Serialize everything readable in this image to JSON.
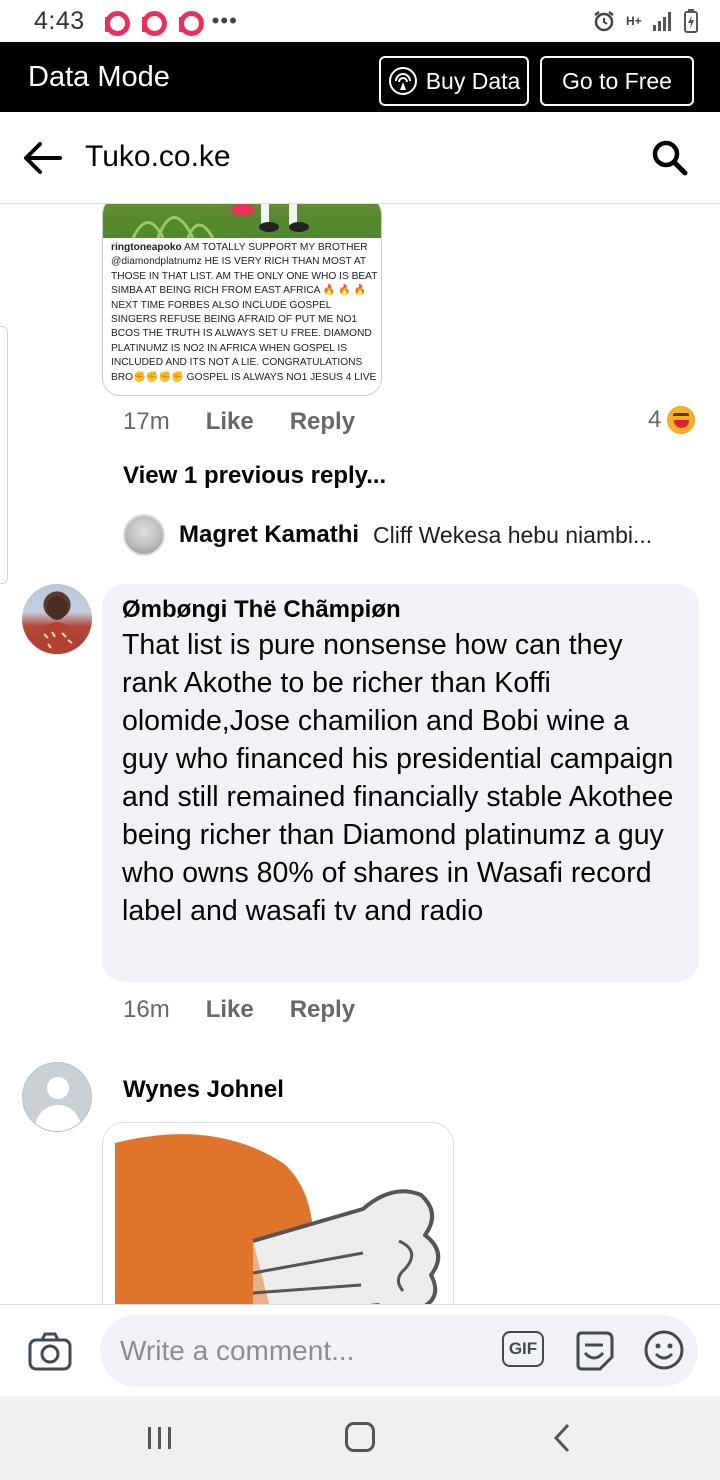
{
  "status_bar": {
    "time": "4:43",
    "dots": "•••",
    "network": "H+"
  },
  "data_mode": {
    "title": "Data Mode",
    "buy_label": "Buy Data",
    "free_label": "Go to Free"
  },
  "header": {
    "title": "Tuko.co.ke"
  },
  "comments": {
    "first": {
      "image_username": "ringtoneapoko",
      "image_text": "AM TOTALLY SUPPORT MY BROTHER @diamondplatnumz HE IS VERY RICH THAN MOST AT THOSE IN THAT LIST. AM THE ONLY ONE WHO IS BEAT SIMBA AT BEING RICH FROM EAST AFRICA 🔥 🔥 🔥 NEXT TIME FORBES ALSO INCLUDE GOSPEL SINGERS REFUSE BEING AFRAID OF PUT ME NO1 BCOS THE TRUTH IS ALWAYS SET U FREE. DIAMOND PLATINUMZ IS NO2 IN AFRICA WHEN GOSPEL IS INCLUDED AND ITS NOT A LIE. CONGRATULATIONS BRO✊✊✊✊ GOSPEL IS ALWAYS NO1 JESUS 4 LIVE",
      "time": "17m",
      "like": "Like",
      "reply": "Reply",
      "reaction_count": "4",
      "view_previous": "View 1 previous reply...",
      "reply_name": "Magret Kamathi",
      "reply_snippet": "Cliff Wekesa hebu niambi..."
    },
    "second": {
      "name": "Ømbøngi Thë Chãmpiøn",
      "text": "That list is pure nonsense how can they rank Akothe to be richer than Koffi olomide,Jose chamilion and Bobi wine a guy who financed his presidential campaign and still remained financially stable Akothee being richer than Diamond platinumz a guy who owns 80% of shares in Wasafi record label and wasafi tv and radio",
      "time": "16m",
      "like": "Like",
      "reply": "Reply"
    },
    "third": {
      "name": "Wynes Johnel"
    }
  },
  "composer": {
    "placeholder": "Write a comment...",
    "gif_label": "GIF"
  },
  "colors": {
    "accent_pink": "#e8305a",
    "bubble_bg": "#f0f2f5",
    "secondary_text": "#65676b"
  },
  "icons": [
    "pocket-icon",
    "alarm-icon",
    "signal-icon",
    "battery-icon",
    "buy-data-icon",
    "back-arrow-icon",
    "search-icon",
    "laugh-reaction-icon",
    "camera-icon",
    "gif-icon",
    "sticker-icon",
    "emoji-icon",
    "recent-apps-icon",
    "home-icon",
    "nav-back-icon"
  ]
}
